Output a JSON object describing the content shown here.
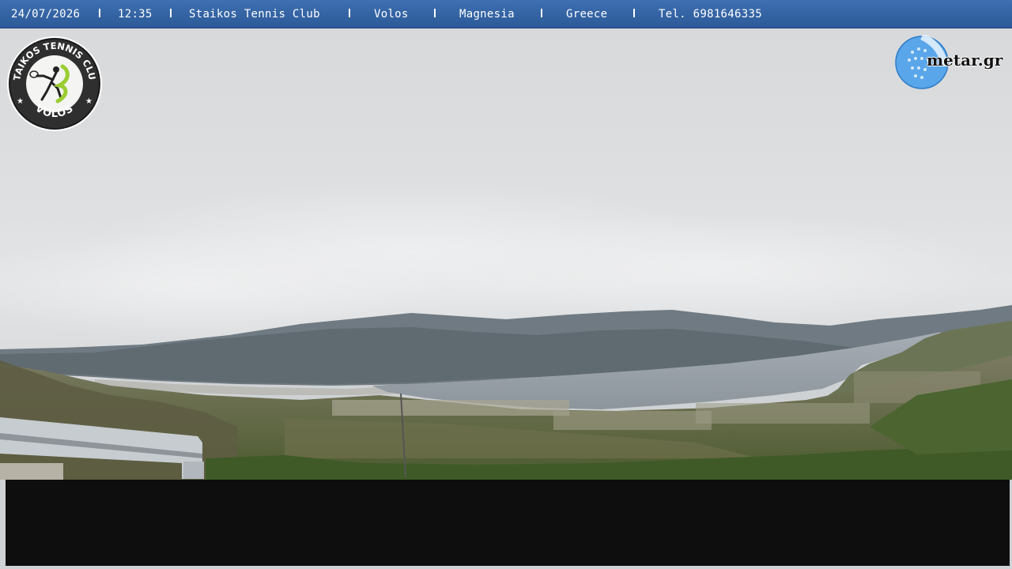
{
  "header": {
    "date": "24/07/2026",
    "time": "12:35",
    "club_name": "Staikos Tennis Club",
    "city": "Volos",
    "region": "Magnesia",
    "country": "Greece",
    "phone": "Tel. 6981646335",
    "separator": "|"
  },
  "club_logo": {
    "text_top": "STAIKOS TENNIS CLUB",
    "text_bottom": "VOLOS"
  },
  "brand": {
    "name": "metar.gr"
  },
  "colors": {
    "header_bar": "#336199",
    "logo_accent": "#9acd32",
    "overlay_panel": "#0e0e0f"
  }
}
